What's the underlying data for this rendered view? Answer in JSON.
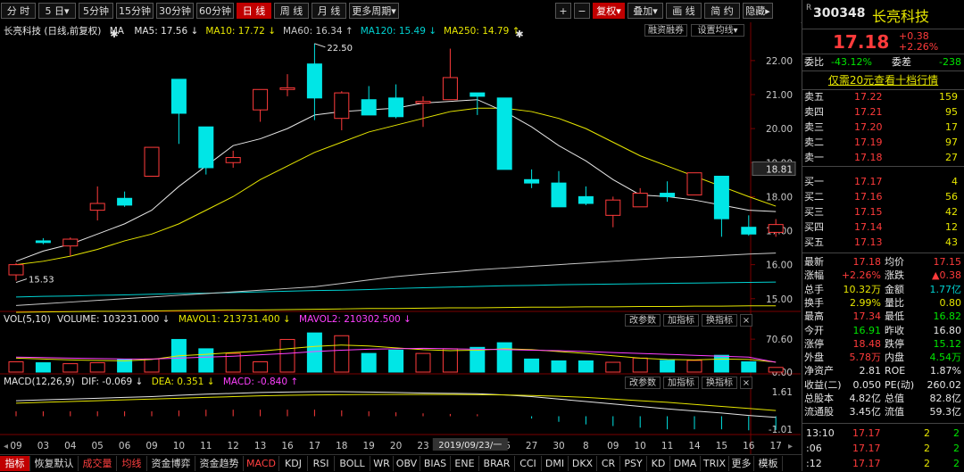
{
  "toolbar": {
    "left": [
      {
        "label": "分 时"
      },
      {
        "label": "5 日▾"
      },
      {
        "label": "5分钟"
      },
      {
        "label": "15分钟"
      },
      {
        "label": "30分钟"
      },
      {
        "label": "60分钟"
      },
      {
        "label": "日 线",
        "active": true
      },
      {
        "label": "周 线"
      },
      {
        "label": "月 线"
      },
      {
        "label": "更多周期▾"
      }
    ],
    "right": [
      {
        "label": "+"
      },
      {
        "label": "−"
      },
      {
        "label": "复权▾",
        "active": true
      },
      {
        "label": "叠加▾"
      },
      {
        "label": "画 线"
      },
      {
        "label": "简 约"
      },
      {
        "label": "隐藏▸"
      }
    ]
  },
  "main_header": {
    "stock_name": "长亮科技",
    "mode": "(日线,前复权)",
    "ma_label": "MA",
    "ma_items": [
      {
        "text": "MA5: 17.56 ↓",
        "color": "#e6e6e6"
      },
      {
        "text": "MA10: 17.72 ↓",
        "color": "#e6e600"
      },
      {
        "text": "MA60: 16.34 ↑",
        "color": "#c8c8c8"
      },
      {
        "text": "MA120: 15.49 ↓",
        "color": "#00d2d2"
      },
      {
        "text": "MA250: 14.79 ↑",
        "color": "#e6e600"
      }
    ],
    "btn_margin": "融资融券",
    "btn_ma": "设置均线▾"
  },
  "vol_header": {
    "label": "VOL(5,10)",
    "volume": "VOLUME: 103231.000 ↓",
    "mavol1": "MAVOL1: 213731.400 ↓",
    "mavol2": "MAVOL2: 210302.500 ↓",
    "btn_param": "改参数",
    "btn_add": "加指标",
    "btn_switch": "换指标",
    "btn_close": "×"
  },
  "macd_header": {
    "label": "MACD(12,26,9)",
    "dif": "DIF: -0.069 ↓",
    "dea": "DEA: 0.351 ↓",
    "macd": "MACD: -0.840 ↑",
    "btn_param": "改参数",
    "btn_add": "加指标",
    "btn_switch": "换指标",
    "btn_close": "×"
  },
  "price_axis": {
    "ticks": [
      "22.00",
      "21.00",
      "20.00",
      "19.00",
      "18.00",
      "17.00",
      "16.00",
      "15.00"
    ],
    "current": "18.81"
  },
  "vol_axis": {
    "ticks": [
      "70.60",
      "0.00"
    ]
  },
  "macd_axis": {
    "ticks": [
      "1.61",
      "-1.01"
    ]
  },
  "annotations": {
    "high": "22.50",
    "low": "15.53"
  },
  "date_axis": {
    "ticks": [
      "09",
      "03",
      "04",
      "05",
      "06",
      "09",
      "10",
      "11",
      "12",
      "13",
      "16",
      "17",
      "18",
      "19",
      "20",
      "23",
      "24",
      "25",
      "26",
      "27",
      "30",
      "8",
      "09",
      "10",
      "11",
      "14",
      "15",
      "16",
      "17"
    ],
    "highlight": "2019/09/23/一"
  },
  "chart_data": {
    "type": "candlestick",
    "candles": [
      {
        "o": 15.7,
        "h": 16.05,
        "l": 15.53,
        "c": 16.0
      },
      {
        "o": 16.7,
        "h": 16.78,
        "l": 16.6,
        "c": 16.65
      },
      {
        "o": 16.55,
        "h": 16.8,
        "l": 16.25,
        "c": 16.75
      },
      {
        "o": 17.6,
        "h": 18.3,
        "l": 17.3,
        "c": 17.8
      },
      {
        "o": 17.95,
        "h": 18.15,
        "l": 17.7,
        "c": 17.75
      },
      {
        "o": 18.6,
        "h": 19.45,
        "l": 18.6,
        "c": 19.45
      },
      {
        "o": 21.45,
        "h": 21.45,
        "l": 19.55,
        "c": 20.45
      },
      {
        "o": 20.05,
        "h": 20.05,
        "l": 18.65,
        "c": 18.85
      },
      {
        "o": 19.0,
        "h": 19.35,
        "l": 18.85,
        "c": 19.15
      },
      {
        "o": 20.55,
        "h": 21.15,
        "l": 20.2,
        "c": 21.15
      },
      {
        "o": 21.15,
        "h": 21.6,
        "l": 20.95,
        "c": 21.2
      },
      {
        "o": 21.9,
        "h": 22.5,
        "l": 20.25,
        "c": 20.9
      },
      {
        "o": 20.3,
        "h": 21.1,
        "l": 19.95,
        "c": 21.05
      },
      {
        "o": 20.85,
        "h": 21.25,
        "l": 20.4,
        "c": 20.4
      },
      {
        "o": 20.9,
        "h": 21.3,
        "l": 20.3,
        "c": 20.35
      },
      {
        "o": 20.75,
        "h": 20.95,
        "l": 20.05,
        "c": 20.8
      },
      {
        "o": 20.85,
        "h": 22.35,
        "l": 20.85,
        "c": 21.5
      },
      {
        "o": 21.05,
        "h": 21.05,
        "l": 20.4,
        "c": 20.95
      },
      {
        "o": 20.9,
        "h": 20.9,
        "l": 18.8,
        "c": 18.8
      },
      {
        "o": 18.5,
        "h": 18.8,
        "l": 18.25,
        "c": 18.4
      },
      {
        "o": 18.4,
        "h": 18.75,
        "l": 17.7,
        "c": 17.7
      },
      {
        "o": 18.0,
        "h": 18.3,
        "l": 17.75,
        "c": 17.8
      },
      {
        "o": 17.45,
        "h": 18.0,
        "l": 17.1,
        "c": 17.9
      },
      {
        "o": 17.7,
        "h": 18.25,
        "l": 17.7,
        "c": 18.1
      },
      {
        "o": 18.1,
        "h": 18.45,
        "l": 17.85,
        "c": 18.0
      },
      {
        "o": 18.05,
        "h": 18.7,
        "l": 18.05,
        "c": 18.7
      },
      {
        "o": 18.6,
        "h": 18.6,
        "l": 16.82,
        "c": 17.35
      },
      {
        "o": 17.1,
        "h": 17.45,
        "l": 16.85,
        "c": 16.9
      },
      {
        "o": 16.95,
        "h": 17.34,
        "l": 16.82,
        "c": 17.18
      }
    ],
    "ma5": [
      16.1,
      16.4,
      16.6,
      16.9,
      17.2,
      17.6,
      18.3,
      18.9,
      19.5,
      19.7,
      20.0,
      20.4,
      20.5,
      20.55,
      20.6,
      20.75,
      20.8,
      20.85,
      20.5,
      20.05,
      19.5,
      19.05,
      18.5,
      18.05,
      18.0,
      17.9,
      17.75,
      17.6,
      17.56
    ],
    "ma10": [
      16.0,
      16.1,
      16.25,
      16.45,
      16.7,
      16.9,
      17.2,
      17.6,
      18.0,
      18.5,
      18.9,
      19.3,
      19.6,
      19.9,
      20.1,
      20.3,
      20.5,
      20.6,
      20.6,
      20.5,
      20.3,
      20.0,
      19.6,
      19.2,
      18.9,
      18.6,
      18.3,
      18.0,
      17.72
    ],
    "ma60": [
      14.8,
      14.85,
      14.9,
      14.95,
      15.0,
      15.05,
      15.1,
      15.15,
      15.2,
      15.25,
      15.3,
      15.35,
      15.45,
      15.55,
      15.65,
      15.72,
      15.78,
      15.85,
      15.9,
      15.95,
      16.0,
      16.05,
      16.1,
      16.15,
      16.2,
      16.23,
      16.27,
      16.31,
      16.34
    ],
    "ma120": [
      15.05,
      15.07,
      15.08,
      15.1,
      15.11,
      15.13,
      15.15,
      15.16,
      15.18,
      15.2,
      15.22,
      15.24,
      15.25,
      15.27,
      15.3,
      15.32,
      15.34,
      15.36,
      15.38,
      15.39,
      15.41,
      15.42,
      15.43,
      15.44,
      15.45,
      15.46,
      15.47,
      15.48,
      15.49
    ],
    "ma250": [
      14.6,
      14.61,
      14.62,
      14.63,
      14.63,
      14.64,
      14.65,
      14.66,
      14.67,
      14.67,
      14.68,
      14.69,
      14.7,
      14.71,
      14.71,
      14.72,
      14.73,
      14.73,
      14.74,
      14.75,
      14.75,
      14.76,
      14.76,
      14.77,
      14.77,
      14.78,
      14.78,
      14.79,
      14.79
    ],
    "volume": [
      22,
      20,
      18,
      20,
      27,
      28,
      70,
      50,
      40,
      22,
      70,
      84,
      78,
      40,
      47,
      40,
      50,
      53,
      63,
      28,
      24,
      24,
      21,
      30,
      25,
      25,
      36,
      22,
      10
    ],
    "mavol1": [
      30,
      28,
      26,
      25,
      24,
      27,
      35,
      38,
      42,
      45,
      50,
      55,
      58,
      56,
      52,
      48,
      46,
      47,
      50,
      48,
      44,
      40,
      35,
      30,
      27,
      26,
      28,
      27,
      21.4
    ],
    "mavol2": [
      32,
      31,
      30,
      29,
      28,
      28,
      30,
      32,
      34,
      37,
      40,
      44,
      47,
      49,
      50,
      51,
      50,
      49,
      48,
      47,
      46,
      44,
      42,
      40,
      38,
      36,
      34,
      32,
      21.0
    ],
    "dif": [
      0.95,
      1.0,
      1.05,
      1.1,
      1.15,
      1.2,
      1.28,
      1.35,
      1.4,
      1.45,
      1.48,
      1.5,
      1.5,
      1.48,
      1.45,
      1.42,
      1.4,
      1.38,
      1.3,
      1.2,
      1.05,
      0.9,
      0.75,
      0.6,
      0.45,
      0.32,
      0.2,
      0.05,
      -0.069
    ],
    "dea": [
      0.8,
      0.85,
      0.9,
      0.95,
      1.0,
      1.05,
      1.1,
      1.15,
      1.2,
      1.25,
      1.28,
      1.3,
      1.32,
      1.33,
      1.33,
      1.33,
      1.33,
      1.32,
      1.3,
      1.27,
      1.22,
      1.15,
      1.05,
      0.95,
      0.85,
      0.72,
      0.6,
      0.48,
      0.351
    ],
    "macd": [
      0.3,
      0.3,
      0.3,
      0.3,
      0.3,
      0.3,
      0.35,
      0.4,
      0.4,
      0.4,
      0.4,
      0.4,
      0.36,
      0.3,
      0.24,
      0.18,
      0.14,
      0.12,
      0.0,
      -0.14,
      -0.34,
      -0.5,
      -0.6,
      -0.7,
      -0.8,
      -0.8,
      -0.8,
      -0.86,
      -0.84
    ],
    "ylim": [
      14.6,
      22.6
    ]
  },
  "right_panel": {
    "code": "300348",
    "name": "长亮科技",
    "price": "17.18",
    "change": "+0.38",
    "change_pct": "+2.26%",
    "weibi_label": "委比",
    "weibi": "-43.12%",
    "weicha_label": "委差",
    "weicha": "-238",
    "promo": "仅需20元查看十档行情",
    "asks": [
      {
        "label": "卖五",
        "price": "17.22",
        "vol": "159"
      },
      {
        "label": "卖四",
        "price": "17.21",
        "vol": "95"
      },
      {
        "label": "卖三",
        "price": "17.20",
        "vol": "17"
      },
      {
        "label": "卖二",
        "price": "17.19",
        "vol": "97"
      },
      {
        "label": "卖一",
        "price": "17.18",
        "vol": "27"
      }
    ],
    "bids": [
      {
        "label": "买一",
        "price": "17.17",
        "vol": "4"
      },
      {
        "label": "买二",
        "price": "17.16",
        "vol": "56"
      },
      {
        "label": "买三",
        "price": "17.15",
        "vol": "42"
      },
      {
        "label": "买四",
        "price": "17.14",
        "vol": "12"
      },
      {
        "label": "买五",
        "price": "17.13",
        "vol": "43"
      }
    ],
    "stats": [
      {
        "l1": "最新",
        "v1": "17.18",
        "c1": "red",
        "l2": "均价",
        "v2": "17.15",
        "c2": "red"
      },
      {
        "l1": "涨幅",
        "v1": "+2.26%",
        "c1": "red",
        "l2": "涨跌",
        "v2": "▲0.38",
        "c2": "red"
      },
      {
        "l1": "总手",
        "v1": "10.32万",
        "c1": "yellow",
        "l2": "金额",
        "v2": "1.77亿",
        "c2": "cyan"
      },
      {
        "l1": "换手",
        "v1": "2.99%",
        "c1": "yellow",
        "l2": "量比",
        "v2": "0.80",
        "c2": "yellow"
      },
      {
        "l1": "最高",
        "v1": "17.34",
        "c1": "red",
        "l2": "最低",
        "v2": "16.82",
        "c2": "green"
      },
      {
        "l1": "今开",
        "v1": "16.91",
        "c1": "green",
        "l2": "昨收",
        "v2": "16.80",
        "c2": "white"
      },
      {
        "l1": "涨停",
        "v1": "18.48",
        "c1": "red",
        "l2": "跌停",
        "v2": "15.12",
        "c2": "green"
      },
      {
        "l1": "外盘",
        "v1": "5.78万",
        "c1": "red",
        "l2": "内盘",
        "v2": "4.54万",
        "c2": "green"
      },
      {
        "l1": "净资产",
        "v1": "2.81",
        "c1": "white",
        "l2": "ROE",
        "v2": "1.87%",
        "c2": "white"
      },
      {
        "l1": "收益(二)",
        "v1": "0.050",
        "c1": "white",
        "l2": "PE(动)",
        "v2": "260.02",
        "c2": "white"
      },
      {
        "l1": "总股本",
        "v1": "4.82亿",
        "c1": "white",
        "l2": "总值",
        "v2": "82.8亿",
        "c2": "white"
      },
      {
        "l1": "流通股",
        "v1": "3.45亿",
        "c1": "white",
        "l2": "流值",
        "v2": "59.3亿",
        "c2": "white"
      }
    ],
    "ticks": [
      {
        "time": "13:10",
        "price": "17.17",
        "vol": "2",
        "dir": "2"
      },
      {
        "time": ":06",
        "price": "17.17",
        "vol": "2",
        "dir": "2"
      },
      {
        "time": ":12",
        "price": "17.17",
        "vol": "2",
        "dir": "2"
      }
    ]
  },
  "bottom_tabs": [
    {
      "label": "指标",
      "active": true
    },
    {
      "label": "恢复默认"
    },
    {
      "label": "成交量",
      "sel": true
    },
    {
      "label": "均线",
      "sel": true
    },
    {
      "label": "资金博弈"
    },
    {
      "label": "资金趋势"
    },
    {
      "label": "MACD",
      "sel": true
    },
    {
      "label": "KDJ"
    },
    {
      "label": "RSI"
    },
    {
      "label": "BOLL"
    },
    {
      "label": "WR"
    },
    {
      "label": "OBV"
    },
    {
      "label": "BIAS"
    },
    {
      "label": "ENE"
    },
    {
      "label": "BRAR"
    },
    {
      "label": "CCI"
    },
    {
      "label": "DMI"
    },
    {
      "label": "DKX"
    },
    {
      "label": "CR"
    },
    {
      "label": "PSY"
    },
    {
      "label": "KD"
    },
    {
      "label": "DMA"
    },
    {
      "label": "TRIX"
    },
    {
      "label": "更多"
    },
    {
      "label": "模板"
    }
  ]
}
